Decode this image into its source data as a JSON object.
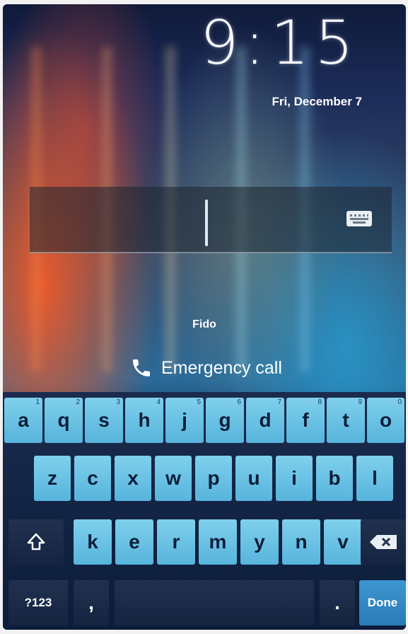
{
  "lockscreen": {
    "time": "9:15",
    "date": "Fri, December 7",
    "carrier": "Fido",
    "emergency_label": "Emergency call"
  },
  "pin_field": {
    "value": "",
    "keyboard_toggle_icon": "keyboard-icon"
  },
  "keyboard": {
    "row1": [
      {
        "label": "a",
        "hint": "1"
      },
      {
        "label": "q",
        "hint": "2"
      },
      {
        "label": "s",
        "hint": "3"
      },
      {
        "label": "h",
        "hint": "4"
      },
      {
        "label": "j",
        "hint": "5"
      },
      {
        "label": "g",
        "hint": "6"
      },
      {
        "label": "d",
        "hint": "7"
      },
      {
        "label": "f",
        "hint": "8"
      },
      {
        "label": "t",
        "hint": "9"
      },
      {
        "label": "o",
        "hint": "0"
      }
    ],
    "row2": [
      "z",
      "c",
      "x",
      "w",
      "p",
      "u",
      "i",
      "b",
      "l"
    ],
    "row3": [
      "k",
      "e",
      "r",
      "m",
      "y",
      "n",
      "v"
    ],
    "shift_icon": "shift-arrow-icon",
    "backspace_icon": "backspace-icon",
    "symbols_label": "?123",
    "comma_label": ",",
    "period_label": ".",
    "done_label": "Done"
  },
  "colors": {
    "key_face": "#6cc3e6",
    "key_text": "#0c1e3a",
    "done_key": "#3d96d0"
  }
}
